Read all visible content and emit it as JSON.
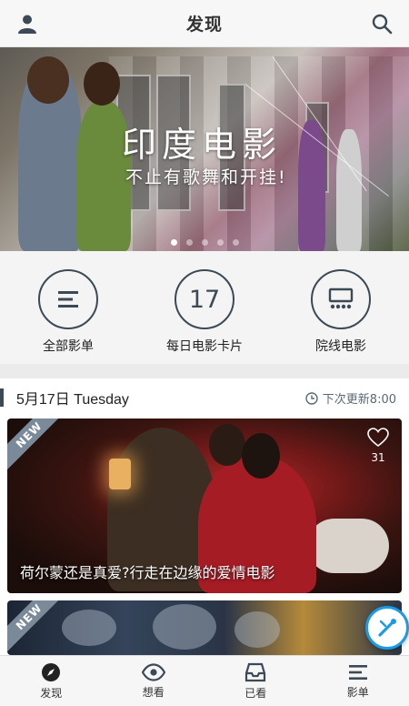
{
  "header": {
    "title": "发现",
    "left_icon": "user-icon",
    "right_icon": "search-icon"
  },
  "banner": {
    "headline": "印度电影",
    "subline": "不止有歌舞和开挂!",
    "page_count": 5,
    "active_index": 0
  },
  "categories": [
    {
      "label": "全部影单",
      "icon": "list-icon"
    },
    {
      "label": "每日电影卡片",
      "number": "17"
    },
    {
      "label": "院线电影",
      "icon": "cinema-icon"
    }
  ],
  "section": {
    "date": "5月17日 Tuesday",
    "next_update": "下次更新8:00",
    "next_icon": "clock-icon"
  },
  "cards": [
    {
      "badge": "NEW",
      "caption": "荷尔蒙还是真爱?行走在边缘的爱情电影",
      "likes": "31"
    },
    {
      "badge": "NEW"
    }
  ],
  "tabbar": {
    "items": [
      {
        "label": "发现",
        "icon": "compass-icon"
      },
      {
        "label": "想看",
        "icon": "eye-icon"
      },
      {
        "label": "已看",
        "icon": "inbox-icon"
      },
      {
        "label": "影单",
        "icon": "list-icon"
      }
    ]
  },
  "colors": {
    "accent": "#3b4a55",
    "fab": "#1a9be6"
  }
}
